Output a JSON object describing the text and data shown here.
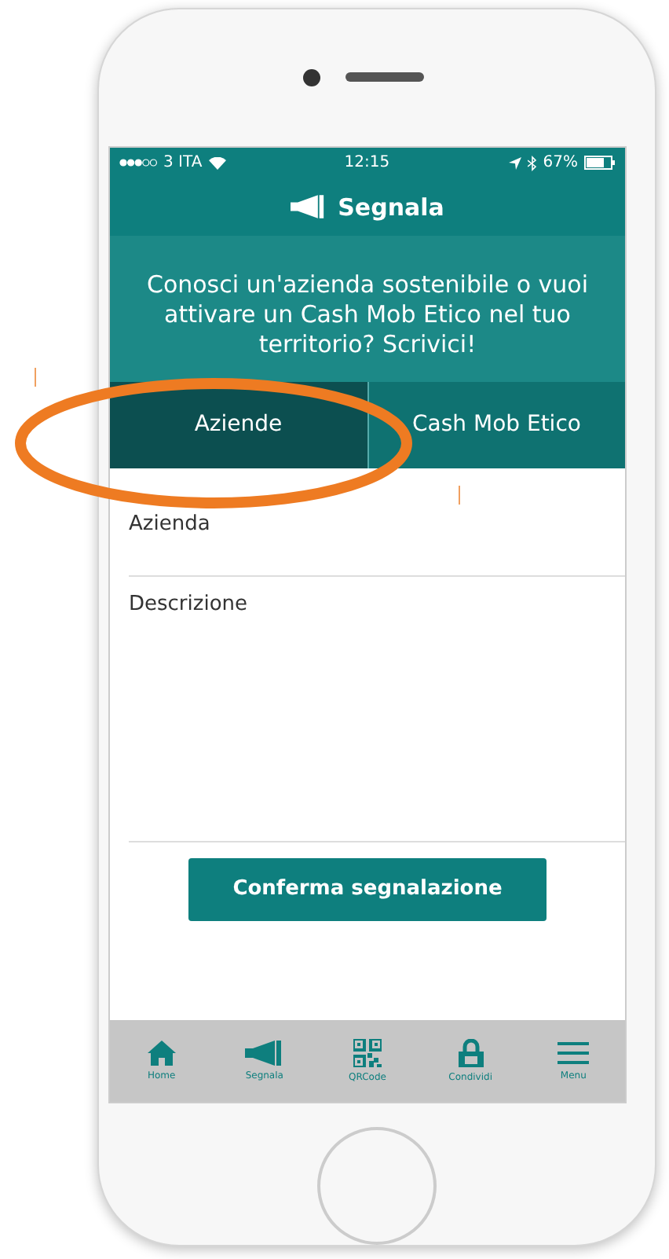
{
  "status_bar": {
    "carrier": "3 ITA",
    "time": "12:15",
    "battery": "67%"
  },
  "header": {
    "title": "Segnala"
  },
  "intro": "Conosci un'azienda sostenibile o vuoi attivare un Cash Mob Etico nel tuo territorio? Scrivici!",
  "tabs": [
    {
      "label": "Aziende",
      "selected": true
    },
    {
      "label": "Cash Mob Etico",
      "selected": false
    }
  ],
  "form": {
    "fields": [
      {
        "label": "Azienda",
        "kind": "line"
      },
      {
        "label": "Descrizione",
        "kind": "area"
      }
    ],
    "submit": "Conferma segnalazione"
  },
  "bottom_nav": [
    {
      "label": "Home",
      "kind": "home"
    },
    {
      "label": "Segnala",
      "kind": "megaphone"
    },
    {
      "label": "QRCode",
      "kind": "qr"
    },
    {
      "label": "Condividi",
      "kind": "share"
    },
    {
      "label": "Menu",
      "kind": "menu"
    }
  ]
}
